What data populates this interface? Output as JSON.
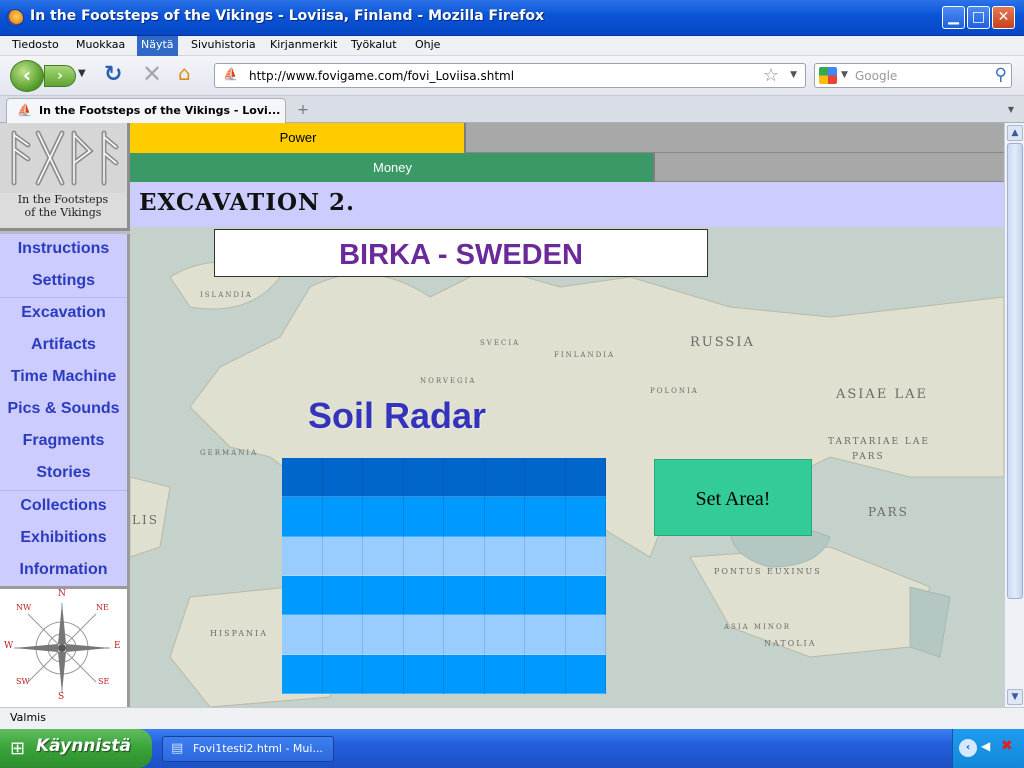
{
  "window": {
    "title": "In the Footsteps of the Vikings - Loviisa, Finland - Mozilla Firefox",
    "minimize_glyph": "▁",
    "maximize_glyph": "□",
    "close_glyph": "✕"
  },
  "menubar": {
    "items": [
      "Tiedosto",
      "Muokkaa",
      "Näytä",
      "Sivuhistoria",
      "Kirjanmerkit",
      "Työkalut",
      "Ohje"
    ],
    "active_index": 2
  },
  "toolbar": {
    "url": "http://www.fovigame.com/fovi_Loviisa.shtml",
    "search_placeholder": "Google"
  },
  "tabs": [
    {
      "title": "In the Footsteps of the Vikings - Lovi..."
    }
  ],
  "logo": {
    "caption_line1": "In the Footsteps",
    "caption_line2": "of the Vikings"
  },
  "bars": {
    "power": {
      "label": "Power",
      "fraction": 0.385,
      "color": "#ffcc00"
    },
    "money": {
      "label": "Money",
      "fraction": 0.601,
      "color": "#3a9966"
    }
  },
  "heading": "EXCAVATION 2.",
  "nav": [
    "Instructions",
    "Settings",
    "Excavation",
    "Artifacts",
    "Time Machine",
    "Pics & Sounds",
    "Fragments",
    "Stories",
    "Collections",
    "Exhibitions",
    "Information"
  ],
  "compass": {
    "n": "N",
    "s": "S",
    "e": "E",
    "w": "W",
    "ne": "NE",
    "nw": "NW",
    "se": "SE",
    "sw": "SW"
  },
  "site": "BIRKA - SWEDEN",
  "radar": {
    "title": "Soil Radar",
    "columns": 8,
    "row_colors": [
      "#0066cc",
      "#0099ff",
      "#99ccff",
      "#0099ff",
      "#99ccff",
      "#0099ff"
    ]
  },
  "set_area_label": "Set Area!",
  "map_labels": [
    "RUSSIA",
    "ASIAE LAE",
    "TARTARIAE LAE",
    "PARS",
    "PARS",
    "PONTUS EUXINUS",
    "NATOLIA",
    "ASIA MINOR",
    "HISPANIA",
    "ISLANDIA",
    "SVECIA",
    "NORVEGIA",
    "GERMANIA",
    "POLONIA",
    "FINLANDIA",
    "LIS"
  ],
  "status": "Valmis",
  "taskbar": {
    "start_label": "Käynnistä",
    "task_item": "Fovi1testi2.html - Mui..."
  }
}
